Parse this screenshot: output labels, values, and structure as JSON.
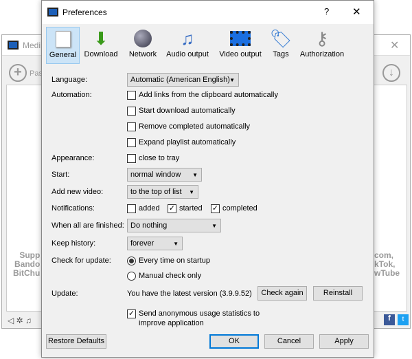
{
  "background_window": {
    "title": "Medi",
    "paste_label": "Pas",
    "left_text": [
      "Supp",
      "Bando",
      "BitChu"
    ],
    "right_text": [
      "com,",
      "kTok,",
      "wTube"
    ]
  },
  "dialog": {
    "title": "Preferences",
    "help": "?",
    "close": "✕"
  },
  "tabs": [
    {
      "label": "General",
      "icon": "switch-icon",
      "selected": true
    },
    {
      "label": "Download",
      "icon": "download-arrow-icon"
    },
    {
      "label": "Network",
      "icon": "globe-icon"
    },
    {
      "label": "Audio output",
      "icon": "music-note-icon"
    },
    {
      "label": "Video output",
      "icon": "film-icon"
    },
    {
      "label": "Tags",
      "icon": "tag-icon"
    },
    {
      "label": "Authorization",
      "icon": "keys-icon"
    }
  ],
  "general": {
    "language": {
      "label": "Language:",
      "value": "Automatic (American English)"
    },
    "automation": {
      "label": "Automation:",
      "options": [
        {
          "label": "Add links from the clipboard automatically",
          "checked": false
        },
        {
          "label": "Start download automatically",
          "checked": false
        },
        {
          "label": "Remove completed automatically",
          "checked": false
        },
        {
          "label": "Expand playlist automatically",
          "checked": false
        }
      ]
    },
    "appearance": {
      "label": "Appearance:",
      "option": "close to tray",
      "checked": false
    },
    "start": {
      "label": "Start:",
      "value": "normal window"
    },
    "add_new_video": {
      "label": "Add new video:",
      "value": "to the top of list"
    },
    "notifications": {
      "label": "Notifications:",
      "options": [
        {
          "label": "added",
          "checked": false
        },
        {
          "label": "started",
          "checked": true
        },
        {
          "label": "completed",
          "checked": true
        }
      ]
    },
    "when_finished": {
      "label": "When all are finished:",
      "value": "Do nothing"
    },
    "keep_history": {
      "label": "Keep history:",
      "value": "forever"
    },
    "check_update": {
      "label": "Check for update:",
      "options": [
        {
          "label": "Every time on startup",
          "selected": true
        },
        {
          "label": "Manual check only",
          "selected": false
        }
      ]
    },
    "update": {
      "label": "Update:",
      "status": "You have the latest version (3.9.9.52)",
      "check_again": "Check again",
      "reinstall": "Reinstall"
    },
    "stats": {
      "line1": "Send anonymous usage statistics to",
      "line2": "improve application",
      "checked": true
    }
  },
  "footer": {
    "restore": "Restore Defaults",
    "ok": "OK",
    "cancel": "Cancel",
    "apply": "Apply"
  }
}
